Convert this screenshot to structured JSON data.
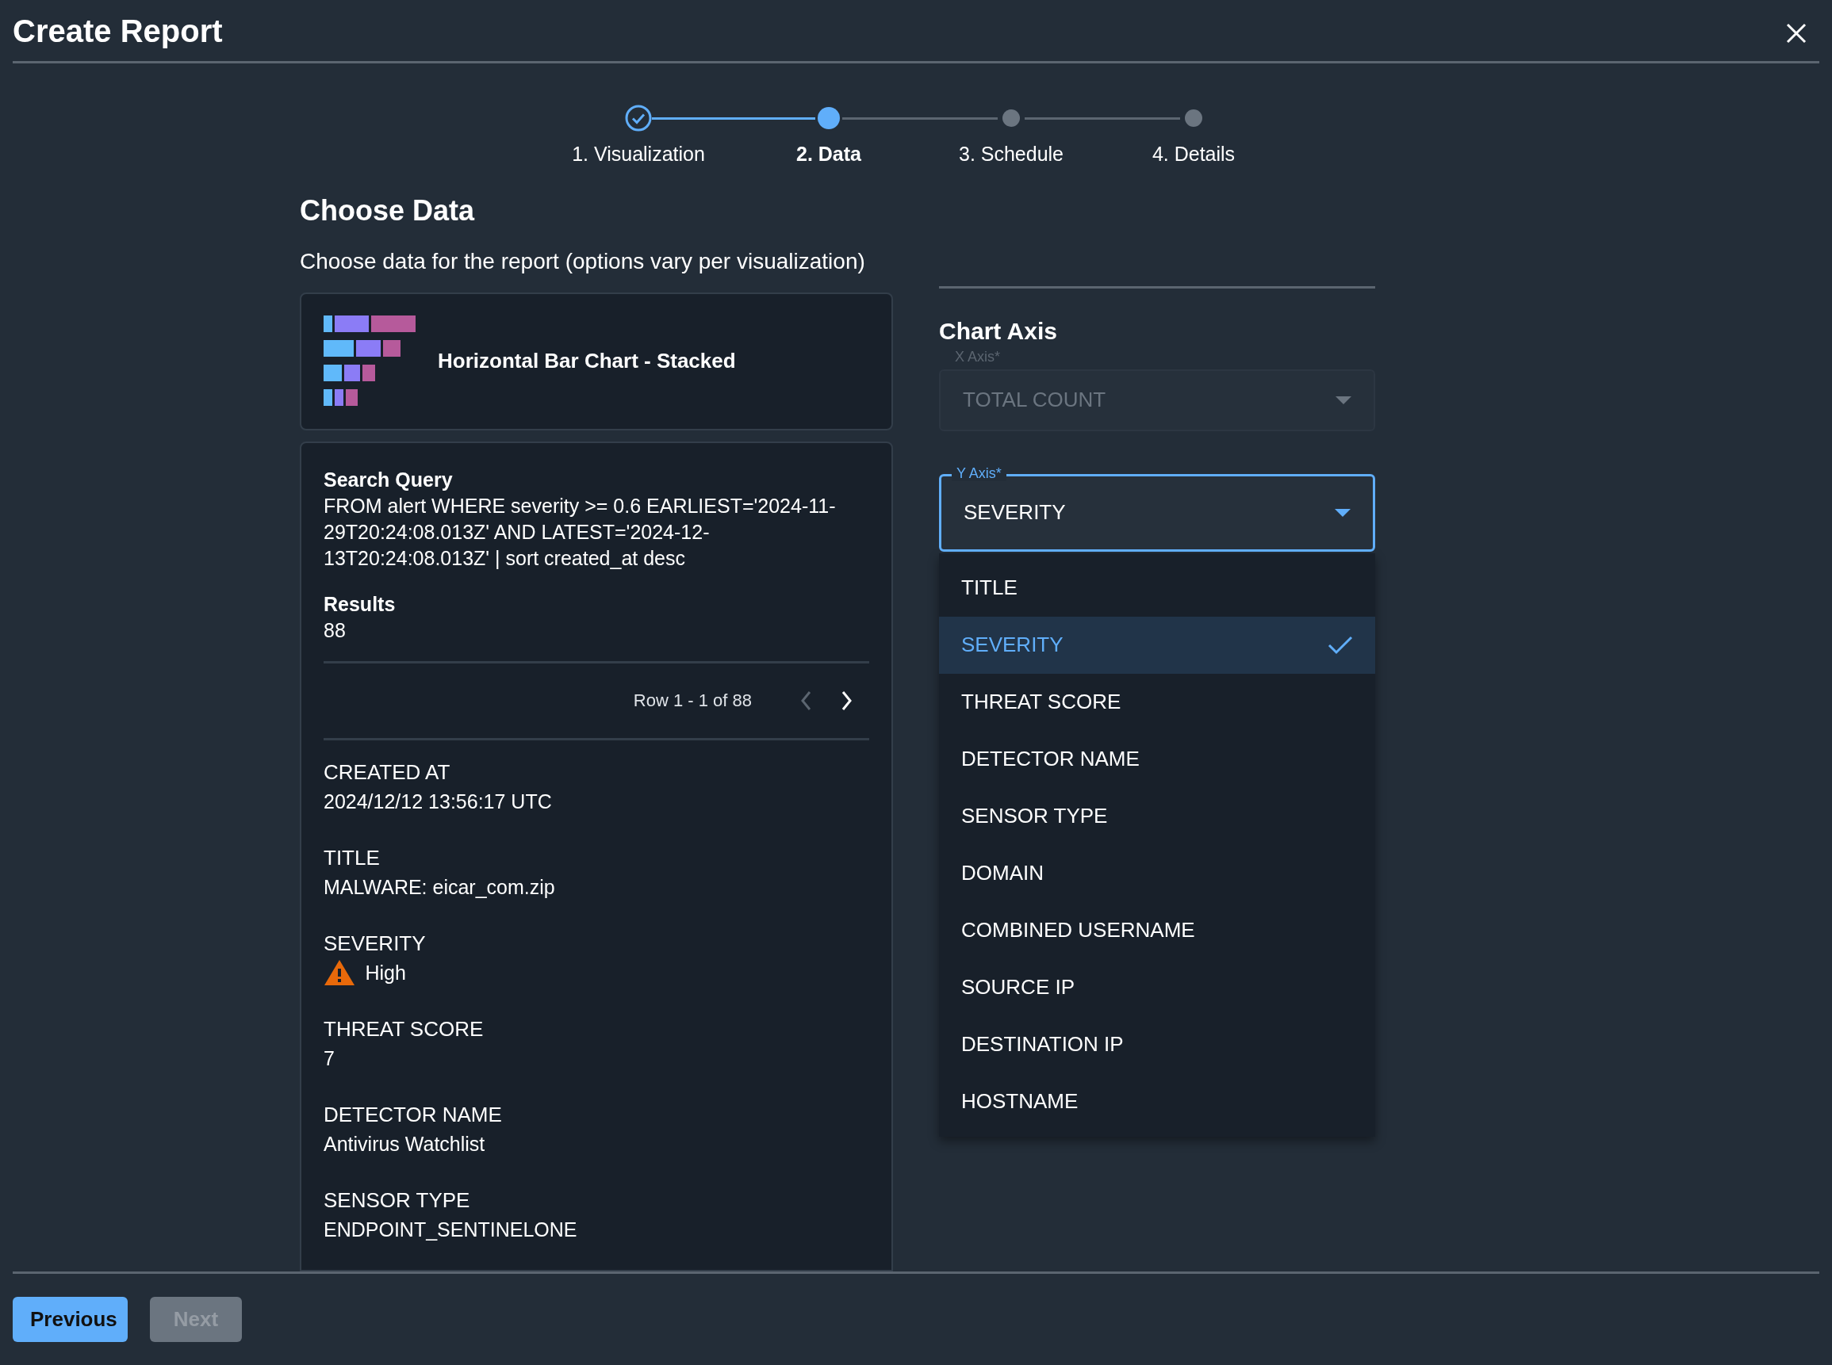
{
  "window": {
    "title": "Create Report"
  },
  "steps": [
    {
      "label": "1. Visualization",
      "completed": true,
      "selected": false
    },
    {
      "label": "2. Data",
      "completed": false,
      "selected": true
    },
    {
      "label": "3. Schedule",
      "completed": false,
      "selected": false
    },
    {
      "label": "4. Details",
      "completed": false,
      "selected": false
    }
  ],
  "heading": "Choose Data",
  "subtitle": "Choose data for the report (options vary per visualization)",
  "visualization": {
    "name": "Horizontal Bar Chart - Stacked"
  },
  "query": {
    "label": "Search Query",
    "text": "FROM alert WHERE severity >= 0.6 EARLIEST='2024-11-29T20:24:08.013Z' AND LATEST='2024-12-13T20:24:08.013Z' | sort created_at desc",
    "results_label": "Results",
    "results": "88"
  },
  "pager": {
    "text": "Row 1 - 1 of 88",
    "prev_disabled": true,
    "next_disabled": false
  },
  "fields": [
    {
      "label": "CREATED AT",
      "value": "2024/12/12 13:56:17 UTC",
      "kind": "text"
    },
    {
      "label": "TITLE",
      "value": "MALWARE: eicar_com.zip",
      "kind": "text"
    },
    {
      "label": "SEVERITY",
      "value": "High",
      "kind": "warning"
    },
    {
      "label": "THREAT SCORE",
      "value": "7",
      "kind": "text"
    },
    {
      "label": "DETECTOR NAME",
      "value": "Antivirus Watchlist",
      "kind": "text"
    },
    {
      "label": "SENSOR TYPE",
      "value": "ENDPOINT_SENTINELONE",
      "kind": "text"
    }
  ],
  "chart_axis": {
    "title": "Chart Axis",
    "x_axis": {
      "label": "X Axis*",
      "value": "TOTAL COUNT",
      "disabled": true
    },
    "y_axis": {
      "label": "Y Axis*",
      "value": "SEVERITY",
      "disabled": false,
      "expanded": true
    },
    "options": [
      {
        "label": "TITLE",
        "selected": false
      },
      {
        "label": "SEVERITY",
        "selected": true
      },
      {
        "label": "THREAT SCORE",
        "selected": false
      },
      {
        "label": "DETECTOR NAME",
        "selected": false
      },
      {
        "label": "SENSOR TYPE",
        "selected": false
      },
      {
        "label": "DOMAIN",
        "selected": false
      },
      {
        "label": "COMBINED USERNAME",
        "selected": false
      },
      {
        "label": "SOURCE IP",
        "selected": false
      },
      {
        "label": "DESTINATION IP",
        "selected": false
      },
      {
        "label": "HOSTNAME",
        "selected": false
      }
    ]
  },
  "buttons": [
    {
      "label": "Previous",
      "disabled": false
    },
    {
      "label": "Next",
      "disabled": true
    }
  ]
}
